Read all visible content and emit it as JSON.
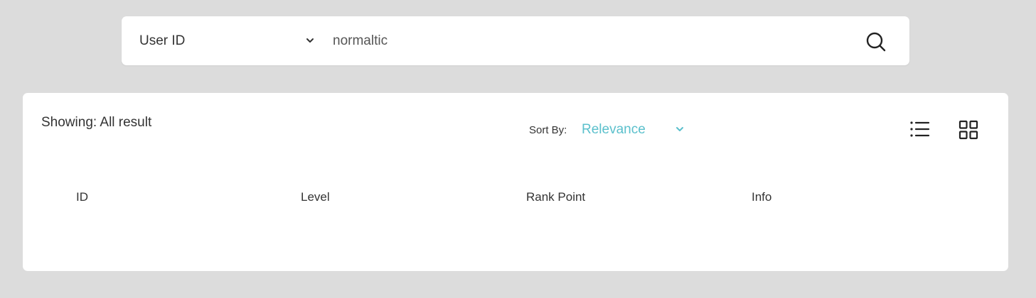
{
  "search": {
    "type_label": "User ID",
    "value": "normaltic",
    "icons": {
      "chevron": "chevron-down-icon",
      "submit": "search-icon"
    }
  },
  "results": {
    "showing_text": "Showing: All result",
    "sort": {
      "label": "Sort By:",
      "value": "Relevance",
      "accent_color": "#5bc0cc"
    },
    "view_toggles": [
      {
        "name": "list-view",
        "icon": "list-icon"
      },
      {
        "name": "grid-view",
        "icon": "grid-icon"
      }
    ],
    "columns": [
      "ID",
      "Level",
      "Rank Point",
      "Info"
    ]
  },
  "colors": {
    "background": "#dcdcdc",
    "panel": "#ffffff",
    "text": "#333333",
    "accent": "#5bc0cc"
  }
}
